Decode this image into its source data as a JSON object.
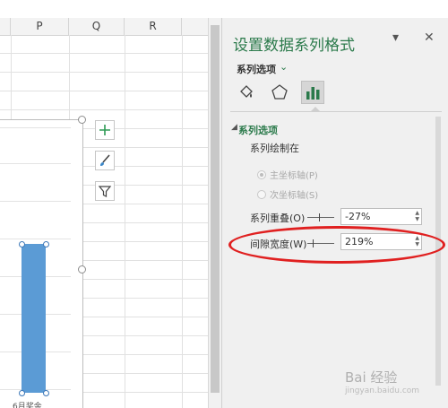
{
  "sheet": {
    "columns": [
      "P",
      "Q",
      "R"
    ],
    "chart_tools": [
      {
        "icon": "plus-icon",
        "label": "chart-elements"
      },
      {
        "icon": "brush-icon",
        "label": "chart-styles"
      },
      {
        "icon": "filter-icon",
        "label": "chart-filters"
      }
    ],
    "x_axis_label": "6月奖金",
    "bar_color": "#5b9bd5"
  },
  "pane": {
    "title": "设置数据系列格式",
    "dropdown_icon": "chevron-down-icon",
    "close_icon": "close-icon",
    "tab_label": "系列选项",
    "icon_tabs": [
      "fill-line-icon",
      "effects-pentagon-icon",
      "series-options-bar-icon"
    ],
    "section_title": "系列选项",
    "plot_on_label": "系列绘制在",
    "radio_primary": "主坐标轴(P)",
    "radio_secondary": "次坐标轴(S)",
    "overlap_label": "系列重叠(O)",
    "overlap_value": "-27%",
    "gap_label": "间隙宽度(W)",
    "gap_value": "219%",
    "accent": "#2b7a4b",
    "highlight_color": "#e02020"
  },
  "watermark": {
    "text": "Bai 经验",
    "sub": "jingyan.baidu.com"
  }
}
